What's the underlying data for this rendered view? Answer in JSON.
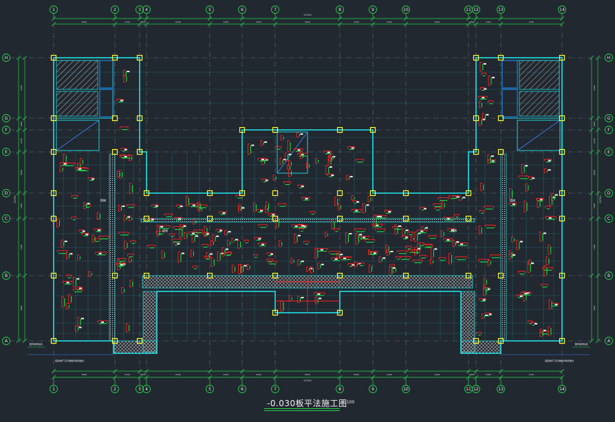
{
  "drawing": {
    "title": "-0.030板平法施工图",
    "scale": "1:100",
    "overall_dimension": "53700"
  },
  "grid_axes_x": [
    "1",
    "2",
    "3",
    "4",
    "5",
    "6",
    "7",
    "8",
    "9",
    "10",
    "11",
    "12",
    "13",
    "14"
  ],
  "grid_axes_y": [
    "A",
    "B",
    "C",
    "D",
    "E",
    "F",
    "G",
    "H"
  ],
  "dimension_text_top": [
    "6600",
    "2700",
    "3300",
    "6300",
    "4200",
    "4200",
    "6600",
    "3300",
    "4200",
    "4200",
    "6300",
    "3300",
    "2700",
    "6600"
  ],
  "dimension_text_side": [
    "4200",
    "6000",
    "2700",
    "6000",
    "3600",
    "1300",
    "3000"
  ],
  "region_labels": [
    "楼梯",
    "楼梯",
    "楼梯",
    "楼梯"
  ],
  "notes": [
    "室外地坪标高",
    "室外地坪标高",
    "首层地坪下另浇楼板详建筑做法",
    "首层地坪下另浇楼板详建筑做法"
  ],
  "colors": {
    "background": "#212830",
    "grid_line": "#6a6e74",
    "dimension": "#27d24a",
    "wall": "#22d0d8",
    "column": "#ffff30",
    "rebar_top": "#ff2020",
    "rebar_bottom": "#20e040",
    "axis_bubble": "#27d24a",
    "hatch": "#b8b8b8",
    "hatch_blue": "#1a60a0"
  }
}
